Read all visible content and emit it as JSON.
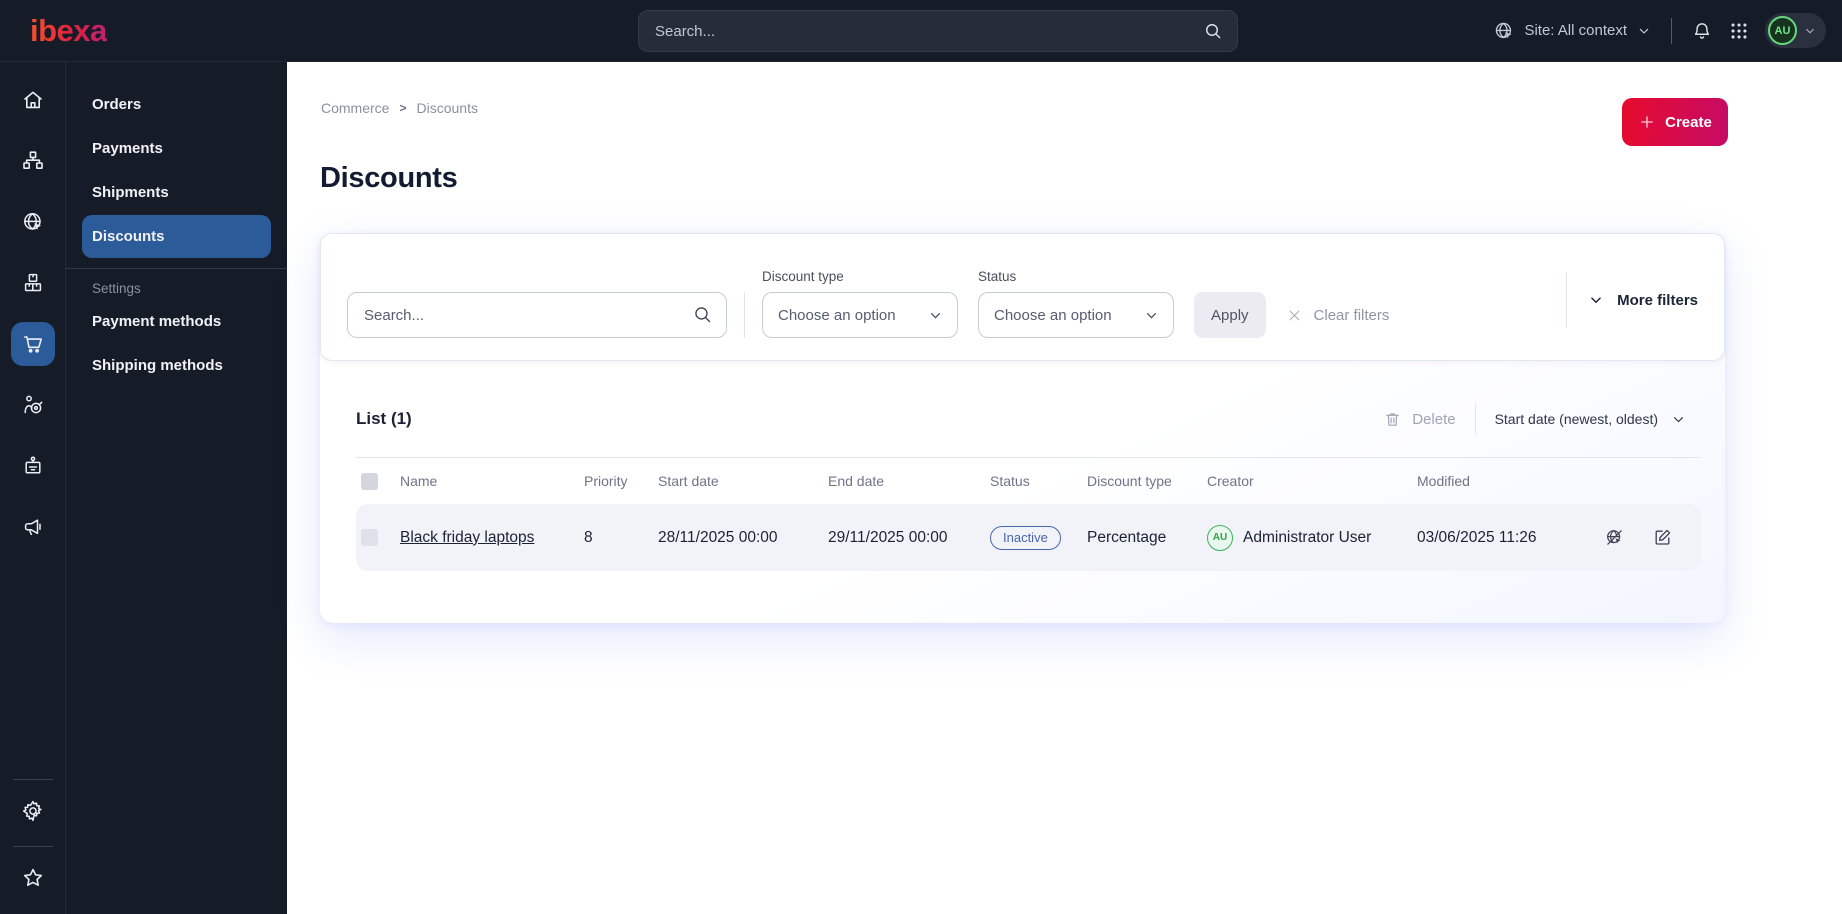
{
  "topbar": {
    "logo_text": "ibexa",
    "search_placeholder": "Search...",
    "site_selector": "Site: All context",
    "user_initials": "AU"
  },
  "sidebar": {
    "rail_icons": [
      "home",
      "sitemap",
      "globe-cursor",
      "boxes",
      "cart",
      "personalization-target",
      "id-badge",
      "megaphone"
    ],
    "rail_active_icon": "cart",
    "rail_bottom_icons": [
      "gear",
      "star"
    ],
    "menu_items": [
      "Orders",
      "Payments",
      "Shipments",
      "Discounts"
    ],
    "active_menu_item": "Discounts",
    "settings_label": "Settings",
    "settings_items": [
      "Payment methods",
      "Shipping methods"
    ]
  },
  "breadcrumb": {
    "items": [
      "Commerce",
      "Discounts"
    ],
    "separator": ">"
  },
  "page": {
    "title": "Discounts",
    "create_button": "Create"
  },
  "filters": {
    "search_placeholder": "Search...",
    "discount_type": {
      "label": "Discount type",
      "value": "Choose an option"
    },
    "status": {
      "label": "Status",
      "value": "Choose an option"
    },
    "apply_button": "Apply",
    "clear_button": "Clear filters",
    "more_filters_button": "More filters"
  },
  "list": {
    "title": "List (1)",
    "delete_button": "Delete",
    "sort_button": "Start date (newest, oldest)",
    "columns": [
      "Name",
      "Priority",
      "Start date",
      "End date",
      "Status",
      "Discount type",
      "Creator",
      "Modified"
    ],
    "rows": [
      {
        "name": "Black friday laptops",
        "priority": "8",
        "start_date": "28/11/2025 00:00",
        "end_date": "29/11/2025 00:00",
        "status": "Inactive",
        "discount_type": "Percentage",
        "creator": "Administrator User",
        "creator_initials": "AU",
        "modified": "03/06/2025 11:26"
      }
    ]
  },
  "colors": {
    "topbar_bg": "#161b28",
    "active_blue": "#2b5c99",
    "brand_gradient_start": "#e60b2d",
    "brand_gradient_end": "#c60b66",
    "status_inactive_blue": "#4767ad",
    "avatar_green": "#41b35c"
  }
}
